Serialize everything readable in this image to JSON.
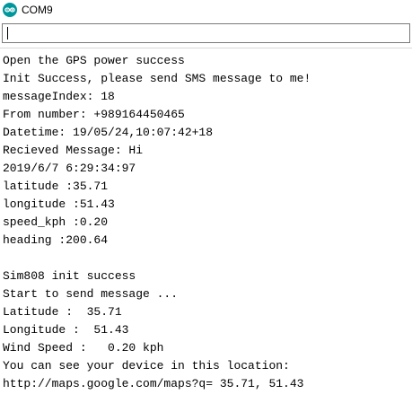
{
  "window": {
    "title": "COM9",
    "icon": "arduino-logo-icon"
  },
  "serial_input": {
    "value": ""
  },
  "output_lines": [
    "Open the GPS power success",
    "Init Success, please send SMS message to me!",
    "messageIndex: 18",
    "From number: +989164450465",
    "Datetime: 19/05/24,10:07:42+18",
    "Recieved Message: Hi",
    "2019/6/7 6:29:34:97",
    "latitude :35.71",
    "longitude :51.43",
    "speed_kph :0.20",
    "heading :200.64",
    "",
    "Sim808 init success",
    "Start to send message ...",
    "Latitude :  35.71",
    "Longitude :  51.43",
    "Wind Speed :   0.20 kph",
    "You can see your device in this location:",
    "http://maps.google.com/maps?q= 35.71, 51.43"
  ],
  "colors": {
    "icon_teal": "#00979c",
    "text": "#000000",
    "border": "#7a7a7a"
  }
}
